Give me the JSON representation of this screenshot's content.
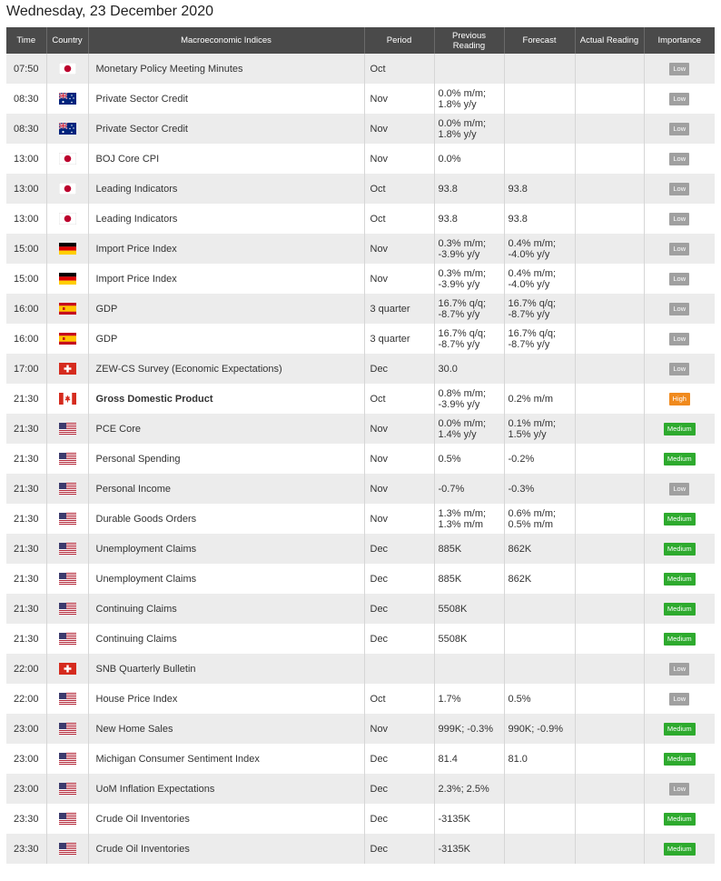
{
  "page": {
    "date_heading": "Wednesday, 23 December 2020"
  },
  "columns": {
    "time": "Time",
    "country": "Country",
    "indices": "Macroeconomic Indices",
    "period": "Period",
    "previous_line1": "Previous",
    "previous_line2": "Reading",
    "forecast": "Forecast",
    "actual": "Actual Reading",
    "importance": "Importance"
  },
  "colors": {
    "low": "#a0a0a0",
    "medium": "#2eaa2e",
    "high": "#f08a1e",
    "header_bg": "#4a4a4a"
  },
  "rows": [
    {
      "time": "07:50",
      "country": "japan",
      "indicator": "Monetary Policy Meeting Minutes",
      "period": "Oct",
      "previous": [
        "",
        ""
      ],
      "forecast": [
        "",
        ""
      ],
      "actual": "",
      "importance": "Low",
      "bold": false
    },
    {
      "time": "08:30",
      "country": "australia",
      "indicator": "Private Sector Credit",
      "period": "Nov",
      "previous": [
        "0.0% m/m;",
        "1.8% y/y"
      ],
      "forecast": [
        "",
        ""
      ],
      "actual": "",
      "importance": "Low",
      "bold": false
    },
    {
      "time": "08:30",
      "country": "australia",
      "indicator": "Private Sector Credit",
      "period": "Nov",
      "previous": [
        "0.0% m/m;",
        "1.8% y/y"
      ],
      "forecast": [
        "",
        ""
      ],
      "actual": "",
      "importance": "Low",
      "bold": false
    },
    {
      "time": "13:00",
      "country": "japan",
      "indicator": "BOJ Core CPI",
      "period": "Nov",
      "previous": [
        "0.0%",
        ""
      ],
      "forecast": [
        "",
        ""
      ],
      "actual": "",
      "importance": "Low",
      "bold": false
    },
    {
      "time": "13:00",
      "country": "japan",
      "indicator": "Leading Indicators",
      "period": "Oct",
      "previous": [
        "93.8",
        ""
      ],
      "forecast": [
        "93.8",
        ""
      ],
      "actual": "",
      "importance": "Low",
      "bold": false
    },
    {
      "time": "13:00",
      "country": "japan",
      "indicator": "Leading Indicators",
      "period": "Oct",
      "previous": [
        "93.8",
        ""
      ],
      "forecast": [
        "93.8",
        ""
      ],
      "actual": "",
      "importance": "Low",
      "bold": false
    },
    {
      "time": "15:00",
      "country": "germany",
      "indicator": "Import Price Index",
      "period": "Nov",
      "previous": [
        "0.3% m/m;",
        "-3.9% y/y"
      ],
      "forecast": [
        "0.4% m/m;",
        "-4.0% y/y"
      ],
      "actual": "",
      "importance": "Low",
      "bold": false
    },
    {
      "time": "15:00",
      "country": "germany",
      "indicator": "Import Price Index",
      "period": "Nov",
      "previous": [
        "0.3% m/m;",
        "-3.9% y/y"
      ],
      "forecast": [
        "0.4% m/m;",
        "-4.0% y/y"
      ],
      "actual": "",
      "importance": "Low",
      "bold": false
    },
    {
      "time": "16:00",
      "country": "spain",
      "indicator": "GDP",
      "period": "3 quarter",
      "previous": [
        "16.7% q/q;",
        "-8.7% y/y"
      ],
      "forecast": [
        "16.7% q/q;",
        "-8.7% y/y"
      ],
      "actual": "",
      "importance": "Low",
      "bold": false
    },
    {
      "time": "16:00",
      "country": "spain",
      "indicator": "GDP",
      "period": "3 quarter",
      "previous": [
        "16.7% q/q;",
        "-8.7% y/y"
      ],
      "forecast": [
        "16.7% q/q;",
        "-8.7% y/y"
      ],
      "actual": "",
      "importance": "Low",
      "bold": false
    },
    {
      "time": "17:00",
      "country": "switzerland",
      "indicator": "ZEW-CS Survey (Economic Expectations)",
      "period": "Dec",
      "previous": [
        "30.0",
        ""
      ],
      "forecast": [
        "",
        ""
      ],
      "actual": "",
      "importance": "Low",
      "bold": false
    },
    {
      "time": "21:30",
      "country": "canada",
      "indicator": "Gross Domestic Product",
      "period": "Oct",
      "previous": [
        "0.8% m/m;",
        "-3.9% y/y"
      ],
      "forecast": [
        "0.2% m/m",
        ""
      ],
      "actual": "",
      "importance": "High",
      "bold": true
    },
    {
      "time": "21:30",
      "country": "usa",
      "indicator": "PCE Core",
      "period": "Nov",
      "previous": [
        "0.0% m/m;",
        "1.4% y/y"
      ],
      "forecast": [
        "0.1% m/m;",
        "1.5% y/y"
      ],
      "actual": "",
      "importance": "Medium",
      "bold": false
    },
    {
      "time": "21:30",
      "country": "usa",
      "indicator": "Personal Spending",
      "period": "Nov",
      "previous": [
        "0.5%",
        ""
      ],
      "forecast": [
        "-0.2%",
        ""
      ],
      "actual": "",
      "importance": "Medium",
      "bold": false
    },
    {
      "time": "21:30",
      "country": "usa",
      "indicator": "Personal Income",
      "period": "Nov",
      "previous": [
        "-0.7%",
        ""
      ],
      "forecast": [
        "-0.3%",
        ""
      ],
      "actual": "",
      "importance": "Low",
      "bold": false
    },
    {
      "time": "21:30",
      "country": "usa",
      "indicator": "Durable Goods Orders",
      "period": "Nov",
      "previous": [
        "1.3% m/m;",
        "1.3% m/m"
      ],
      "forecast": [
        "0.6% m/m;",
        "0.5% m/m"
      ],
      "actual": "",
      "importance": "Medium",
      "bold": false
    },
    {
      "time": "21:30",
      "country": "usa",
      "indicator": "Unemployment Claims",
      "period": "Dec",
      "previous": [
        "885K",
        ""
      ],
      "forecast": [
        "862K",
        ""
      ],
      "actual": "",
      "importance": "Medium",
      "bold": false
    },
    {
      "time": "21:30",
      "country": "usa",
      "indicator": "Unemployment Claims",
      "period": "Dec",
      "previous": [
        "885K",
        ""
      ],
      "forecast": [
        "862K",
        ""
      ],
      "actual": "",
      "importance": "Medium",
      "bold": false
    },
    {
      "time": "21:30",
      "country": "usa",
      "indicator": "Continuing Claims",
      "period": "Dec",
      "previous": [
        "5508K",
        ""
      ],
      "forecast": [
        "",
        ""
      ],
      "actual": "",
      "importance": "Medium",
      "bold": false
    },
    {
      "time": "21:30",
      "country": "usa",
      "indicator": "Continuing Claims",
      "period": "Dec",
      "previous": [
        "5508K",
        ""
      ],
      "forecast": [
        "",
        ""
      ],
      "actual": "",
      "importance": "Medium",
      "bold": false
    },
    {
      "time": "22:00",
      "country": "switzerland",
      "indicator": "SNB Quarterly Bulletin",
      "period": "",
      "previous": [
        "",
        ""
      ],
      "forecast": [
        "",
        ""
      ],
      "actual": "",
      "importance": "Low",
      "bold": false
    },
    {
      "time": "22:00",
      "country": "usa",
      "indicator": "House Price Index",
      "period": "Oct",
      "previous": [
        "1.7%",
        ""
      ],
      "forecast": [
        "0.5%",
        ""
      ],
      "actual": "",
      "importance": "Low",
      "bold": false
    },
    {
      "time": "23:00",
      "country": "usa",
      "indicator": "New Home Sales",
      "period": "Nov",
      "previous": [
        "999K; -0.3%",
        ""
      ],
      "forecast": [
        "990K; -0.9%",
        ""
      ],
      "actual": "",
      "importance": "Medium",
      "bold": false
    },
    {
      "time": "23:00",
      "country": "usa",
      "indicator": "Michigan Consumer Sentiment Index",
      "period": "Dec",
      "previous": [
        "81.4",
        ""
      ],
      "forecast": [
        "81.0",
        ""
      ],
      "actual": "",
      "importance": "Medium",
      "bold": false
    },
    {
      "time": "23:00",
      "country": "usa",
      "indicator": "UoM Inflation Expectations",
      "period": "Dec",
      "previous": [
        "2.3%; 2.5%",
        ""
      ],
      "forecast": [
        "",
        ""
      ],
      "actual": "",
      "importance": "Low",
      "bold": false
    },
    {
      "time": "23:30",
      "country": "usa",
      "indicator": "Crude Oil Inventories",
      "period": "Dec",
      "previous": [
        "-3135K",
        ""
      ],
      "forecast": [
        "",
        ""
      ],
      "actual": "",
      "importance": "Medium",
      "bold": false
    },
    {
      "time": "23:30",
      "country": "usa",
      "indicator": "Crude Oil Inventories",
      "period": "Dec",
      "previous": [
        "-3135K",
        ""
      ],
      "forecast": [
        "",
        ""
      ],
      "actual": "",
      "importance": "Medium",
      "bold": false
    }
  ]
}
